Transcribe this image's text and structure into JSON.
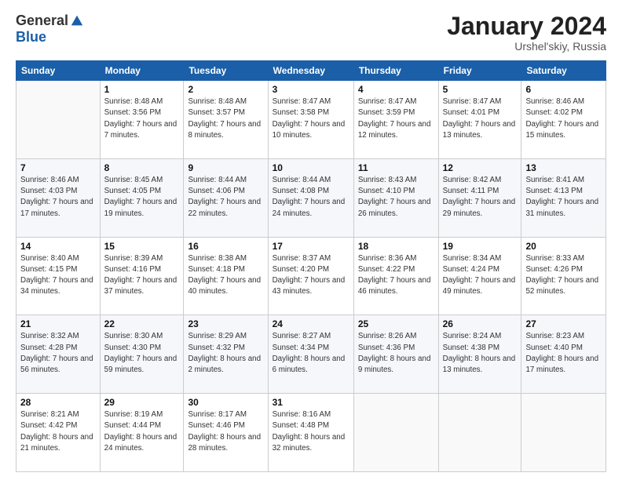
{
  "logo": {
    "general": "General",
    "blue": "Blue"
  },
  "header": {
    "month": "January 2024",
    "location": "Urshel'skiy, Russia"
  },
  "weekdays": [
    "Sunday",
    "Monday",
    "Tuesday",
    "Wednesday",
    "Thursday",
    "Friday",
    "Saturday"
  ],
  "weeks": [
    [
      {
        "day": "",
        "sunrise": "",
        "sunset": "",
        "daylight": ""
      },
      {
        "day": "1",
        "sunrise": "Sunrise: 8:48 AM",
        "sunset": "Sunset: 3:56 PM",
        "daylight": "Daylight: 7 hours and 7 minutes."
      },
      {
        "day": "2",
        "sunrise": "Sunrise: 8:48 AM",
        "sunset": "Sunset: 3:57 PM",
        "daylight": "Daylight: 7 hours and 8 minutes."
      },
      {
        "day": "3",
        "sunrise": "Sunrise: 8:47 AM",
        "sunset": "Sunset: 3:58 PM",
        "daylight": "Daylight: 7 hours and 10 minutes."
      },
      {
        "day": "4",
        "sunrise": "Sunrise: 8:47 AM",
        "sunset": "Sunset: 3:59 PM",
        "daylight": "Daylight: 7 hours and 12 minutes."
      },
      {
        "day": "5",
        "sunrise": "Sunrise: 8:47 AM",
        "sunset": "Sunset: 4:01 PM",
        "daylight": "Daylight: 7 hours and 13 minutes."
      },
      {
        "day": "6",
        "sunrise": "Sunrise: 8:46 AM",
        "sunset": "Sunset: 4:02 PM",
        "daylight": "Daylight: 7 hours and 15 minutes."
      }
    ],
    [
      {
        "day": "7",
        "sunrise": "Sunrise: 8:46 AM",
        "sunset": "Sunset: 4:03 PM",
        "daylight": "Daylight: 7 hours and 17 minutes."
      },
      {
        "day": "8",
        "sunrise": "Sunrise: 8:45 AM",
        "sunset": "Sunset: 4:05 PM",
        "daylight": "Daylight: 7 hours and 19 minutes."
      },
      {
        "day": "9",
        "sunrise": "Sunrise: 8:44 AM",
        "sunset": "Sunset: 4:06 PM",
        "daylight": "Daylight: 7 hours and 22 minutes."
      },
      {
        "day": "10",
        "sunrise": "Sunrise: 8:44 AM",
        "sunset": "Sunset: 4:08 PM",
        "daylight": "Daylight: 7 hours and 24 minutes."
      },
      {
        "day": "11",
        "sunrise": "Sunrise: 8:43 AM",
        "sunset": "Sunset: 4:10 PM",
        "daylight": "Daylight: 7 hours and 26 minutes."
      },
      {
        "day": "12",
        "sunrise": "Sunrise: 8:42 AM",
        "sunset": "Sunset: 4:11 PM",
        "daylight": "Daylight: 7 hours and 29 minutes."
      },
      {
        "day": "13",
        "sunrise": "Sunrise: 8:41 AM",
        "sunset": "Sunset: 4:13 PM",
        "daylight": "Daylight: 7 hours and 31 minutes."
      }
    ],
    [
      {
        "day": "14",
        "sunrise": "Sunrise: 8:40 AM",
        "sunset": "Sunset: 4:15 PM",
        "daylight": "Daylight: 7 hours and 34 minutes."
      },
      {
        "day": "15",
        "sunrise": "Sunrise: 8:39 AM",
        "sunset": "Sunset: 4:16 PM",
        "daylight": "Daylight: 7 hours and 37 minutes."
      },
      {
        "day": "16",
        "sunrise": "Sunrise: 8:38 AM",
        "sunset": "Sunset: 4:18 PM",
        "daylight": "Daylight: 7 hours and 40 minutes."
      },
      {
        "day": "17",
        "sunrise": "Sunrise: 8:37 AM",
        "sunset": "Sunset: 4:20 PM",
        "daylight": "Daylight: 7 hours and 43 minutes."
      },
      {
        "day": "18",
        "sunrise": "Sunrise: 8:36 AM",
        "sunset": "Sunset: 4:22 PM",
        "daylight": "Daylight: 7 hours and 46 minutes."
      },
      {
        "day": "19",
        "sunrise": "Sunrise: 8:34 AM",
        "sunset": "Sunset: 4:24 PM",
        "daylight": "Daylight: 7 hours and 49 minutes."
      },
      {
        "day": "20",
        "sunrise": "Sunrise: 8:33 AM",
        "sunset": "Sunset: 4:26 PM",
        "daylight": "Daylight: 7 hours and 52 minutes."
      }
    ],
    [
      {
        "day": "21",
        "sunrise": "Sunrise: 8:32 AM",
        "sunset": "Sunset: 4:28 PM",
        "daylight": "Daylight: 7 hours and 56 minutes."
      },
      {
        "day": "22",
        "sunrise": "Sunrise: 8:30 AM",
        "sunset": "Sunset: 4:30 PM",
        "daylight": "Daylight: 7 hours and 59 minutes."
      },
      {
        "day": "23",
        "sunrise": "Sunrise: 8:29 AM",
        "sunset": "Sunset: 4:32 PM",
        "daylight": "Daylight: 8 hours and 2 minutes."
      },
      {
        "day": "24",
        "sunrise": "Sunrise: 8:27 AM",
        "sunset": "Sunset: 4:34 PM",
        "daylight": "Daylight: 8 hours and 6 minutes."
      },
      {
        "day": "25",
        "sunrise": "Sunrise: 8:26 AM",
        "sunset": "Sunset: 4:36 PM",
        "daylight": "Daylight: 8 hours and 9 minutes."
      },
      {
        "day": "26",
        "sunrise": "Sunrise: 8:24 AM",
        "sunset": "Sunset: 4:38 PM",
        "daylight": "Daylight: 8 hours and 13 minutes."
      },
      {
        "day": "27",
        "sunrise": "Sunrise: 8:23 AM",
        "sunset": "Sunset: 4:40 PM",
        "daylight": "Daylight: 8 hours and 17 minutes."
      }
    ],
    [
      {
        "day": "28",
        "sunrise": "Sunrise: 8:21 AM",
        "sunset": "Sunset: 4:42 PM",
        "daylight": "Daylight: 8 hours and 21 minutes."
      },
      {
        "day": "29",
        "sunrise": "Sunrise: 8:19 AM",
        "sunset": "Sunset: 4:44 PM",
        "daylight": "Daylight: 8 hours and 24 minutes."
      },
      {
        "day": "30",
        "sunrise": "Sunrise: 8:17 AM",
        "sunset": "Sunset: 4:46 PM",
        "daylight": "Daylight: 8 hours and 28 minutes."
      },
      {
        "day": "31",
        "sunrise": "Sunrise: 8:16 AM",
        "sunset": "Sunset: 4:48 PM",
        "daylight": "Daylight: 8 hours and 32 minutes."
      },
      {
        "day": "",
        "sunrise": "",
        "sunset": "",
        "daylight": ""
      },
      {
        "day": "",
        "sunrise": "",
        "sunset": "",
        "daylight": ""
      },
      {
        "day": "",
        "sunrise": "",
        "sunset": "",
        "daylight": ""
      }
    ]
  ]
}
